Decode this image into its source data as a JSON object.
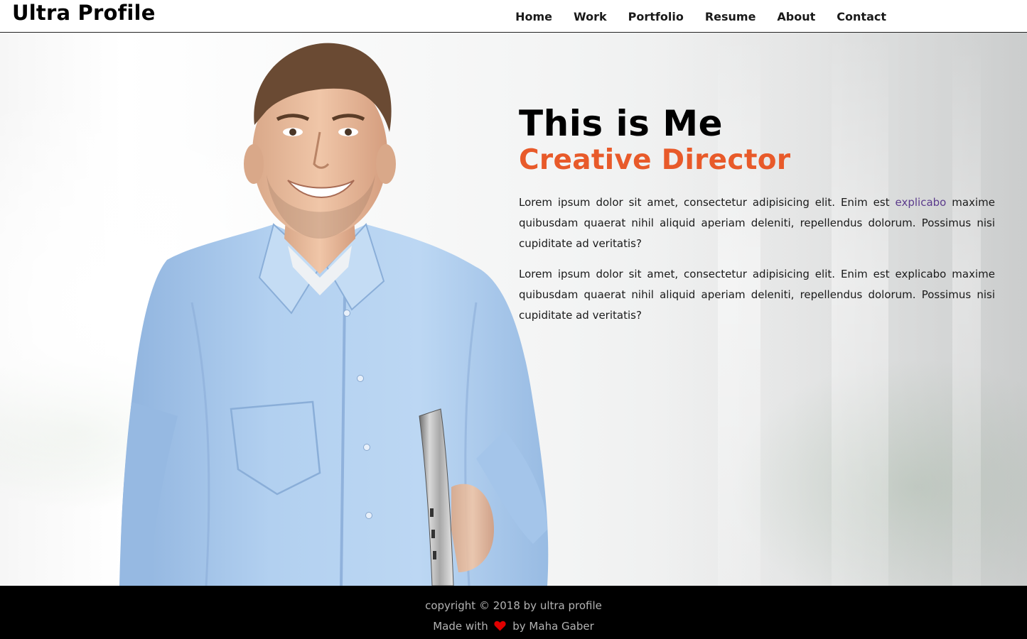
{
  "header": {
    "brand": "Ultra Profile",
    "nav": [
      {
        "label": "Home"
      },
      {
        "label": "Work"
      },
      {
        "label": "Portfolio"
      },
      {
        "label": "Resume"
      },
      {
        "label": "About"
      },
      {
        "label": "Contact"
      }
    ]
  },
  "hero": {
    "title": "This is Me",
    "subtitle": "Creative Director",
    "paragraph_1": {
      "before_link": "Lorem ipsum dolor sit amet, consectetur adipisicing elit. Enim est ",
      "link_text": "explicabo",
      "after_link": " maxime quibusdam quaerat nihil aliquid aperiam deleniti, repellendus dolorum. Possimus nisi cupiditate ad veritatis?"
    },
    "paragraph_2": "Lorem ipsum dolor sit amet, consectetur adipisicing elit. Enim est explicabo maxime quibusdam quaerat nihil aliquid aperiam deleniti, repellendus dolorum. Possimus nisi cupiditate ad veritatis?"
  },
  "footer": {
    "copyright": "copyright © 2018 by ultra profile",
    "made_with_prefix": "Made with",
    "made_with_suffix": "by Maha Gaber",
    "heart_icon": "heart-icon"
  },
  "colors": {
    "accent": "#e85a2a",
    "link": "#5b3b8c",
    "footer_bg": "#000000",
    "footer_text": "#b3b3b3",
    "heart": "#e00000",
    "shirt": "#a9c9ec"
  }
}
